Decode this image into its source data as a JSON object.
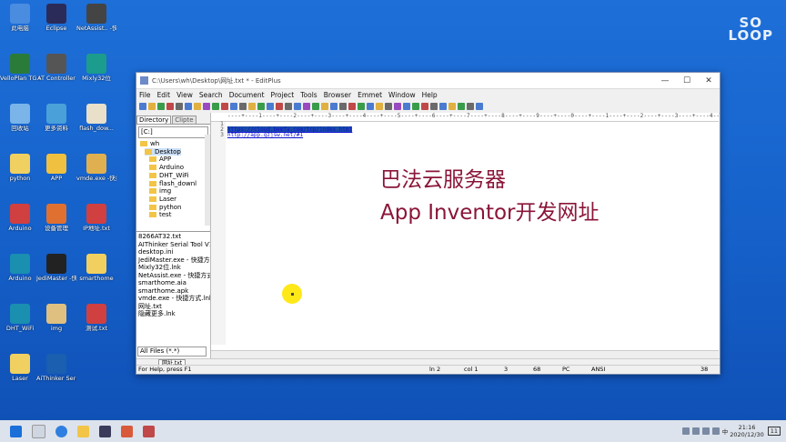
{
  "desktop_icons": [
    {
      "label": "此电脑",
      "color": "#4a8ce0"
    },
    {
      "label": "Eclipse",
      "color": "#2b2b5a"
    },
    {
      "label": "NetAssist.. -快捷方式",
      "color": "#444"
    },
    {
      "label": "VelloPlan TG Qui Sc.",
      "color": "#2a7a3a"
    },
    {
      "label": "AT Controller",
      "color": "#555"
    },
    {
      "label": "Mixly32位",
      "color": "#1b9c8c"
    },
    {
      "label": "回收站",
      "color": "#7ab4e8"
    },
    {
      "label": "更多资料",
      "color": "#4aa0d8"
    },
    {
      "label": "flash_dow...",
      "color": "#e8e0c8"
    },
    {
      "label": "python",
      "color": "#f0d060"
    },
    {
      "label": "APP",
      "color": "#f0c040"
    },
    {
      "label": "vmde.exe -快捷方式",
      "color": "#e0b050"
    },
    {
      "label": "Arduino",
      "color": "#d04040"
    },
    {
      "label": "设备管理",
      "color": "#e07030"
    },
    {
      "label": "IP地址.txt",
      "color": "#d04040"
    },
    {
      "label": "Arduino",
      "color": "#1a8fb0"
    },
    {
      "label": "JediMaster -快捷方式",
      "color": "#222"
    },
    {
      "label": "smarthome",
      "color": "#f2d060"
    },
    {
      "label": "DHT_WiFi",
      "color": "#1a8fb0"
    },
    {
      "label": "img",
      "color": "#e0c080"
    },
    {
      "label": "测试.txt",
      "color": "#d04040"
    },
    {
      "label": "Laser",
      "color": "#f0d060"
    },
    {
      "label": "AiThinker Serial Too...",
      "color": "#1a5fb0"
    }
  ],
  "logo": [
    "SO",
    "LOOP"
  ],
  "window": {
    "title": "C:\\Users\\wh\\Desktop\\网址.txt * - EditPlus",
    "controls": [
      "—",
      "☐",
      "✕"
    ],
    "menu": [
      "File",
      "Edit",
      "View",
      "Search",
      "Document",
      "Project",
      "Tools",
      "Browser",
      "Emmet",
      "Window",
      "Help"
    ]
  },
  "panel": {
    "tabs": [
      "Directory",
      "Clipte"
    ],
    "drive": "[C:]",
    "tree": [
      "wh",
      "Desktop",
      "APP",
      "Arduino",
      "DHT_WiFi",
      "flash_downl",
      "img",
      "Laser",
      "python",
      "test"
    ],
    "files": [
      "8266AT32.txt",
      "AIThinker Serial Tool V1",
      "desktop.ini",
      "JediMaster.exe - 快捷方式",
      "Mixly32位.lnk",
      "NetAssist.exe - 快捷方式",
      "smarthome.aia",
      "smarthome.apk",
      "vmde.exe - 快捷方式.lnk",
      "网址.txt",
      "隐藏更多.lnk"
    ],
    "filter": "All Files (*.*)"
  },
  "editor": {
    "ruler": "----+----1----+----2----+----3----+----4----+----5----+----6----+----7----+----8----+----9----+----0----+----1----+----2----+----3----+----4----+----5----+----6----+----7----+----8----+",
    "line_numbers": [
      "1",
      "2",
      "3"
    ],
    "lines": [
      "",
      "https://cloud.bemfa.com/tcp/index.html",
      "http://app.gzjsw.net/#1"
    ],
    "annotation1": "巴法云服务器",
    "annotation2": "App Inventor开发网址",
    "file_tab": "网址.txt"
  },
  "status": {
    "help": "For Help, press F1",
    "ln": "ln 2",
    "col": "col 1",
    "n1": "3",
    "n2": "68",
    "mode": "PC",
    "enc": "ANSI",
    "n3": "38"
  },
  "tray": {
    "ime": "中",
    "time": "21:16",
    "date": "2020/12/30",
    "notif": "11"
  }
}
